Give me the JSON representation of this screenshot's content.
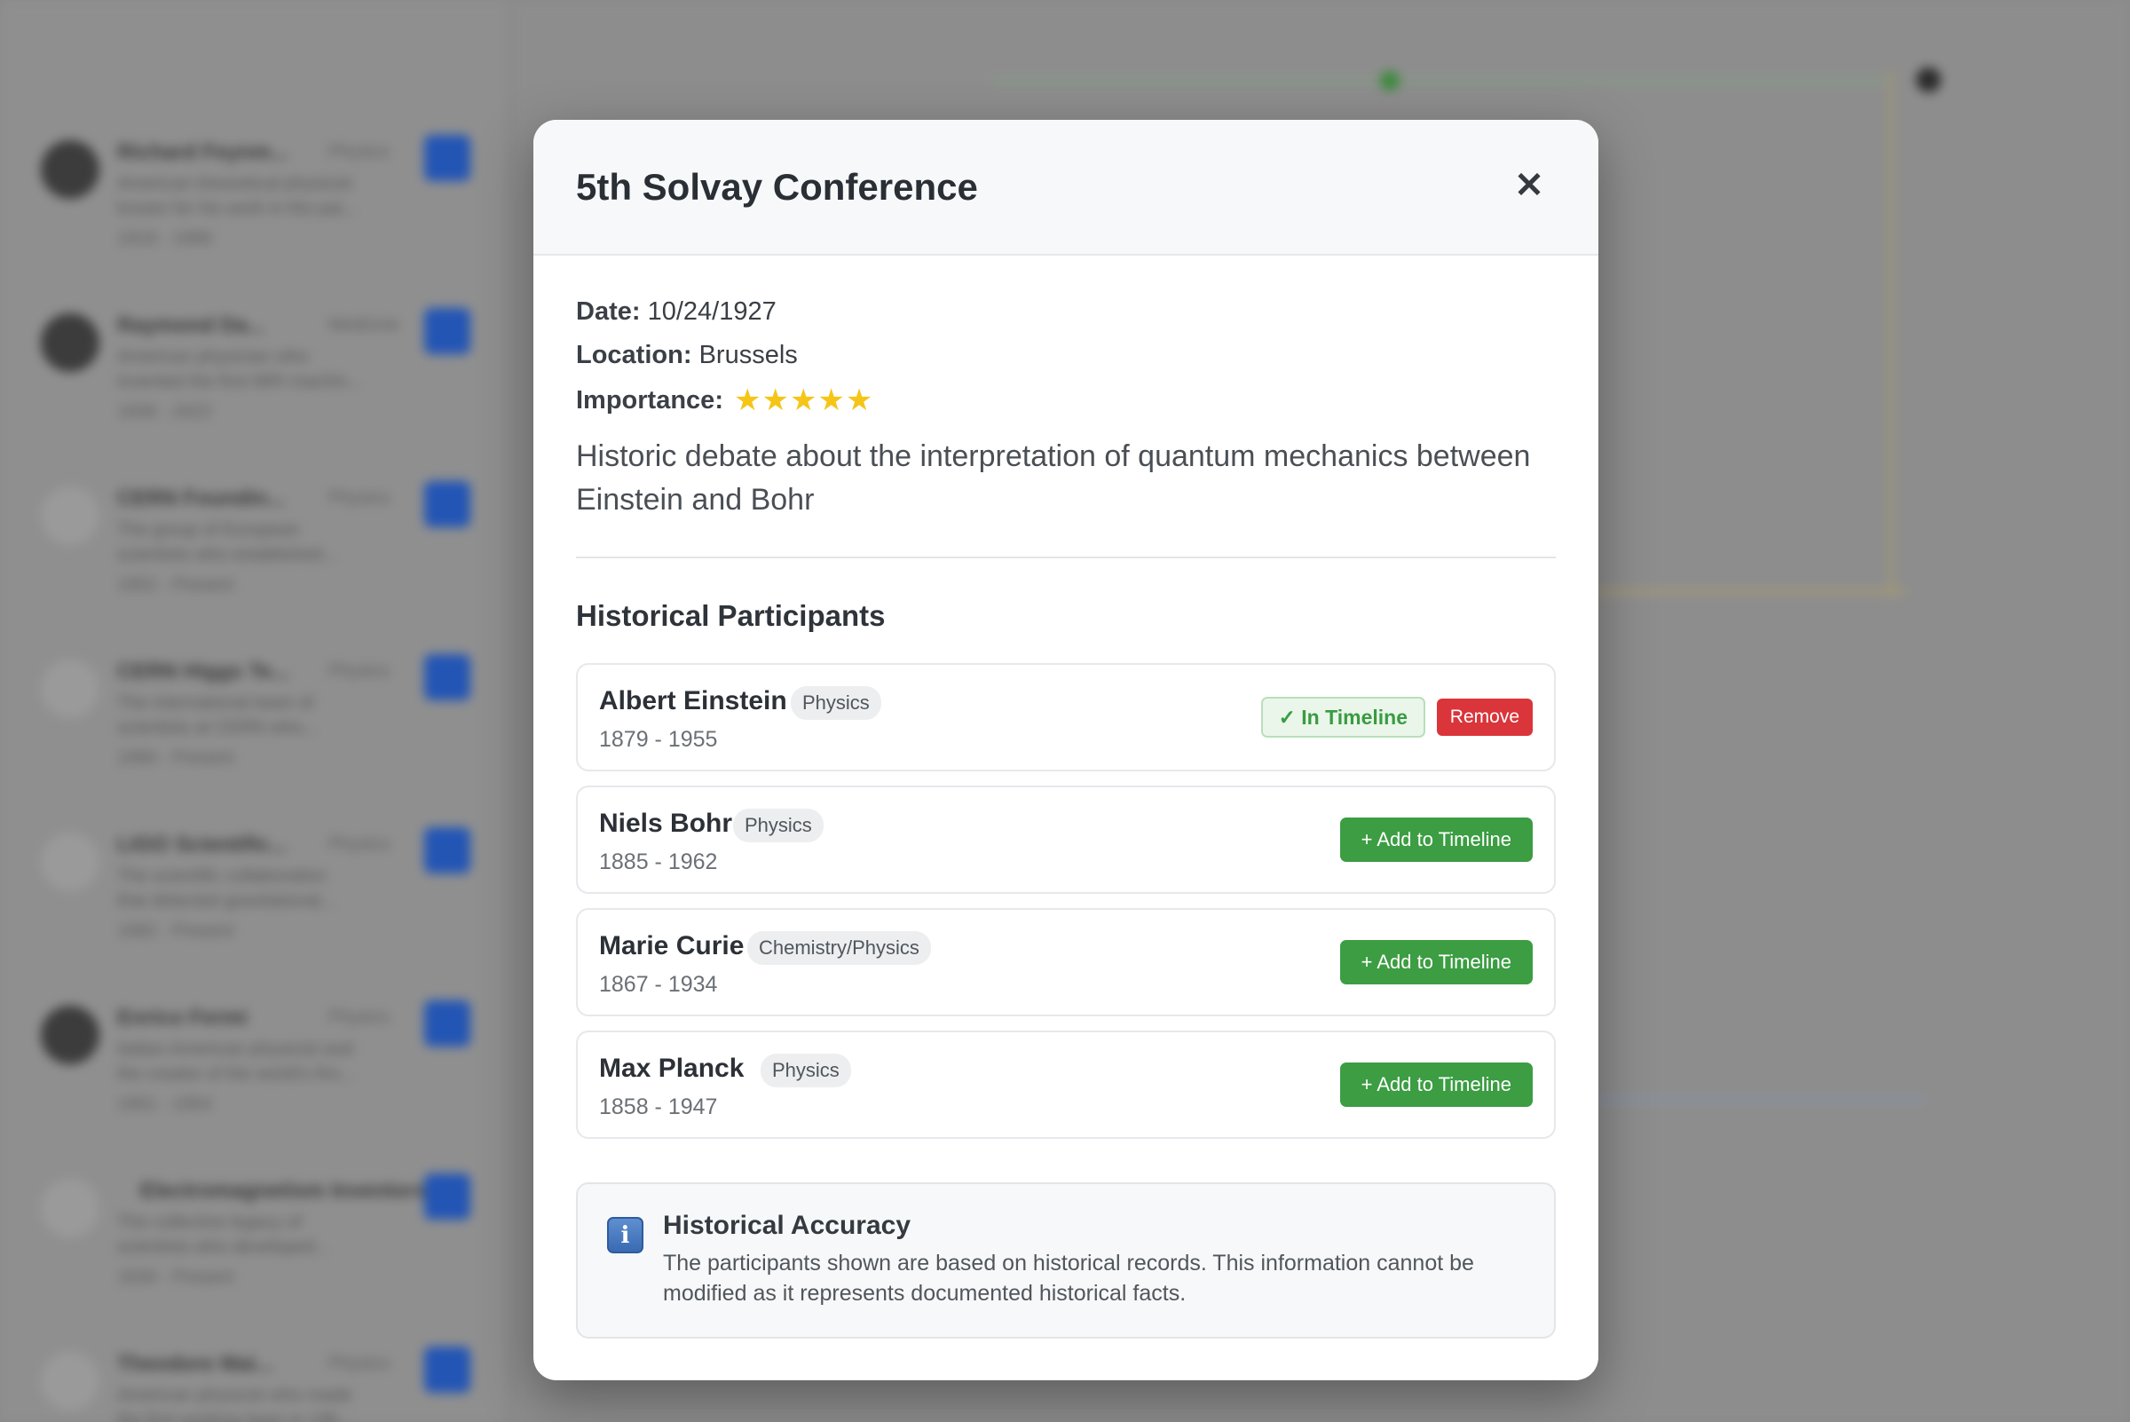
{
  "background": {
    "sidebar_items": [
      {
        "title": "Richard Feynm...",
        "tag": "Physics",
        "line1": "American theoretical physicist",
        "line2": "known for his work in the pat...",
        "years": "1918 - 1988",
        "avatar": "dark"
      },
      {
        "title": "Raymond Da...",
        "tag": "Medicine",
        "line1": "American physician who",
        "line2": "invented the first MRI machin...",
        "years": "1936 - 2022",
        "avatar": "dark"
      },
      {
        "title": "CERN Foundin...",
        "tag": "Physics",
        "line1": "The group of European",
        "line2": "scientists who established...",
        "years": "1952 - Present",
        "avatar": "light"
      },
      {
        "title": "CERN Higgs Te...",
        "tag": "Physics",
        "line1": "The international team of",
        "line2": "scientists at CERN who...",
        "years": "1990 - Present",
        "avatar": "light"
      },
      {
        "title": "LIGO Scientific...",
        "tag": "Physics",
        "line1": "The scientific collaboration",
        "line2": "that detected gravitational...",
        "years": "1992 - Present",
        "avatar": "light"
      },
      {
        "title": "Enrico Fermi",
        "tag": "Physics",
        "line1": "Italian-American physicist and",
        "line2": "the creator of the world's firs...",
        "years": "1901 - 1954",
        "avatar": "dark"
      },
      {
        "title": "Electromagnetism Inventors",
        "tag": "",
        "line1": "The collective legacy of",
        "line2": "scientists who developed...",
        "years": "1830 - Present",
        "avatar": "light"
      },
      {
        "title": "Theodore Mai...",
        "tag": "Physics",
        "line1": "American physicist who made",
        "line2": "the first working laser in 196...",
        "years": "1927 - 2007",
        "avatar": "light"
      }
    ]
  },
  "modal": {
    "title": "5th Solvay Conference",
    "close_glyph": "✕",
    "date_label": "Date:",
    "date_value": "10/24/1927",
    "location_label": "Location:",
    "location_value": "Brussels",
    "importance_label": "Importance:",
    "importance_stars": "★★★★★",
    "importance_rating": 5,
    "description": "Historic debate about the interpretation of quantum mechanics between Einstein and Bohr",
    "participants_title": "Historical Participants",
    "participants": [
      {
        "name": "Albert Einstein",
        "field": "Physics",
        "years": "1879 - 1955",
        "in_timeline": true,
        "status_label": "✓ In Timeline",
        "remove_label": "Remove"
      },
      {
        "name": "Niels Bohr",
        "field": "Physics",
        "years": "1885 - 1962",
        "in_timeline": false,
        "add_label": "+ Add to Timeline"
      },
      {
        "name": "Marie Curie",
        "field": "Chemistry/Physics",
        "years": "1867 - 1934",
        "in_timeline": false,
        "add_label": "+ Add to Timeline"
      },
      {
        "name": "Max Planck",
        "field": "Physics",
        "years": "1858 - 1947",
        "in_timeline": false,
        "add_label": "+ Add to Timeline"
      }
    ],
    "info": {
      "icon": "info-icon",
      "icon_glyph": "i",
      "title": "Historical Accuracy",
      "text": "The participants shown are based on historical records. This information cannot be modified as it represents documented historical facts."
    }
  },
  "colors": {
    "accent_green": "#3c9d43",
    "remove_red": "#d9353b",
    "star_yellow": "#f5c518",
    "sidebar_button_blue": "#2355b5"
  }
}
